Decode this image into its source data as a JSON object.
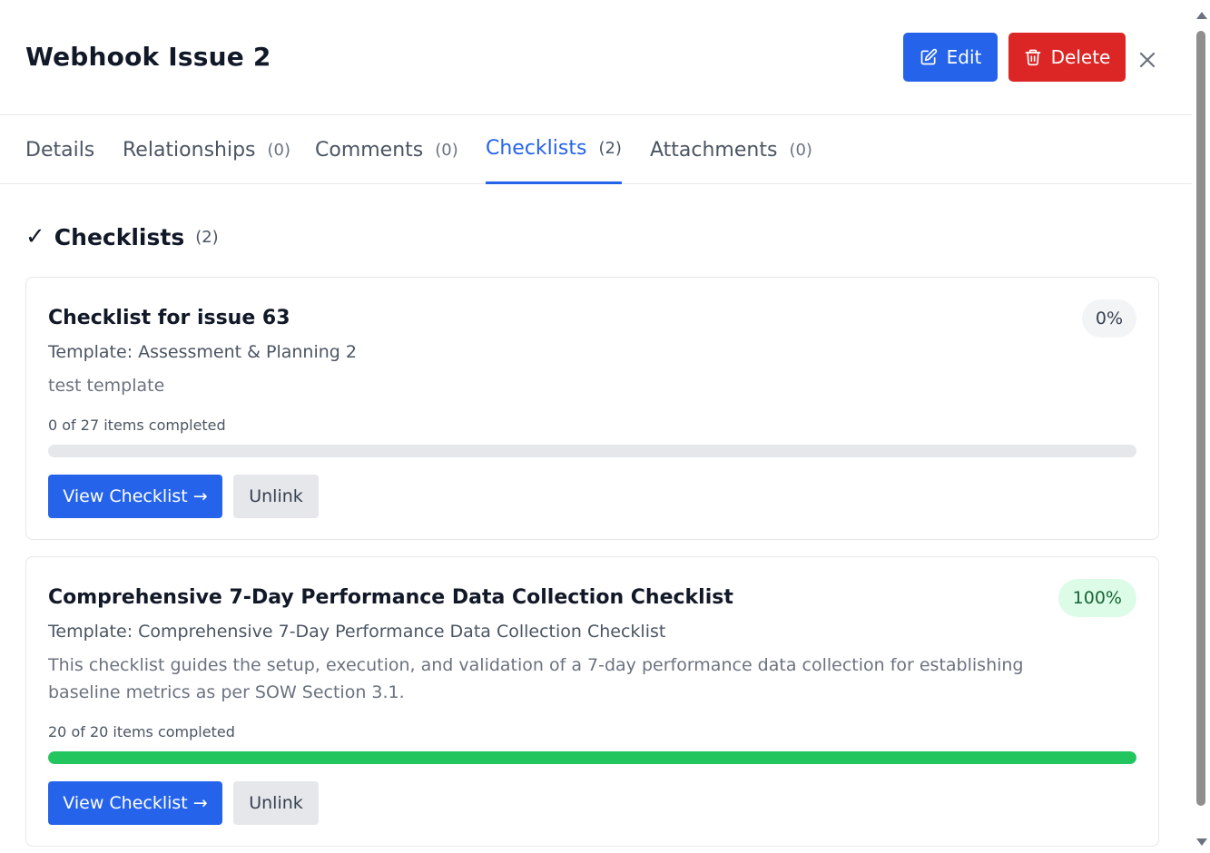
{
  "header": {
    "title": "Webhook Issue 2",
    "edit_label": "Edit",
    "delete_label": "Delete",
    "close_icon": "×"
  },
  "tabs": [
    {
      "label": "Details",
      "count": ""
    },
    {
      "label": "Relationships",
      "count": "(0)"
    },
    {
      "label": "Comments",
      "count": "(0)"
    },
    {
      "label": "Checklists",
      "count": "(2)",
      "active": true
    },
    {
      "label": "Attachments",
      "count": "(0)"
    }
  ],
  "section": {
    "check_glyph": "✓",
    "title": "Checklists",
    "count": "(2)"
  },
  "checklists": [
    {
      "title": "Checklist for issue 63",
      "template": "Template: Assessment & Planning 2",
      "description": "test template",
      "progress_text": "0 of 27 items completed",
      "percent_label": "0%",
      "progress": 0,
      "view_label": "View Checklist →",
      "unlink_label": "Unlink"
    },
    {
      "title": "Comprehensive 7-Day Performance Data Collection Checklist",
      "template": "Template: Comprehensive 7-Day Performance Data Collection Checklist",
      "description": "This checklist guides the setup, execution, and validation of a 7-day performance data collection for establishing baseline metrics as per SOW Section 3.1.",
      "progress_text": "20 of 20 items completed",
      "percent_label": "100%",
      "progress": 1.0,
      "view_label": "View Checklist →",
      "unlink_label": "Unlink"
    }
  ],
  "colors": {
    "primary": "#2563eb",
    "danger": "#dc2626",
    "success": "#22c55e"
  }
}
